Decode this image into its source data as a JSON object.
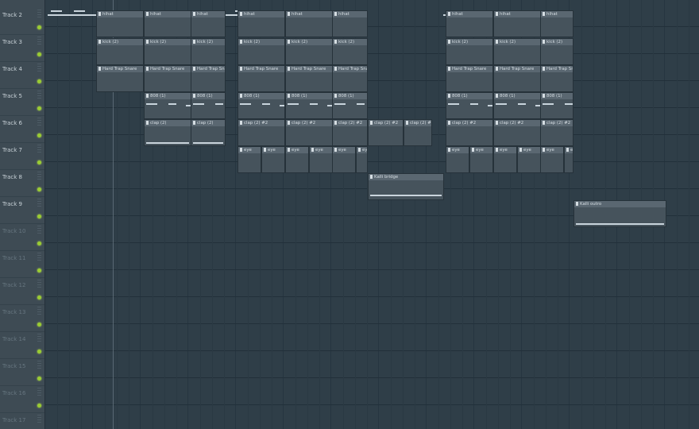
{
  "tracks": [
    {
      "name": "Track 2",
      "active": true
    },
    {
      "name": "Track 3",
      "active": true
    },
    {
      "name": "Track 4",
      "active": true
    },
    {
      "name": "Track 5",
      "active": true
    },
    {
      "name": "Track 6",
      "active": true
    },
    {
      "name": "Track 7",
      "active": true
    },
    {
      "name": "Track 8",
      "active": true
    },
    {
      "name": "Track 9",
      "active": true
    },
    {
      "name": "Track 10",
      "active": false
    },
    {
      "name": "Track 11",
      "active": false
    },
    {
      "name": "Track 12",
      "active": false
    },
    {
      "name": "Track 13",
      "active": false
    },
    {
      "name": "Track 14",
      "active": false
    },
    {
      "name": "Track 15",
      "active": false
    },
    {
      "name": "Track 16",
      "active": false
    },
    {
      "name": "Track 17",
      "active": false
    }
  ],
  "clips": {
    "hihat": "hihat",
    "kick": "kick (2)",
    "snare": "Hard Trap Snare",
    "eight08": "808 (1)",
    "clap": "clap (2)",
    "clap2": "clap (2) #2",
    "clap3": "clap (2) #3",
    "eye": "eye",
    "bridge": "Kalli bridge",
    "outro": "Kalli outro"
  },
  "colors": {
    "background": "#2f3d47",
    "clip": "#4e5b64",
    "led": "#9acd32"
  }
}
